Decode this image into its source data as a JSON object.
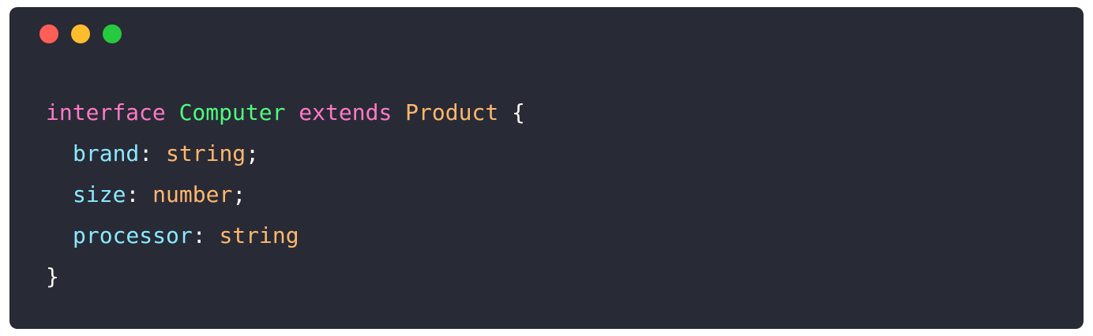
{
  "window_controls": {
    "close_color": "#ff5f56",
    "minimize_color": "#ffbd2e",
    "maximize_color": "#27c93f"
  },
  "colors": {
    "background": "#282a36",
    "keyword": "#ff79c6",
    "class_name": "#50fa7b",
    "type": "#ffb86c",
    "property": "#8be9fd",
    "punctuation": "#f8f8f2"
  },
  "code": {
    "line1": {
      "keyword1": "interface",
      "name": "Computer",
      "keyword2": "extends",
      "base": "Product",
      "brace": "{"
    },
    "line2": {
      "prop": "brand",
      "colon": ":",
      "type": "string",
      "semi": ";"
    },
    "line3": {
      "prop": "size",
      "colon": ":",
      "type": "number",
      "semi": ";"
    },
    "line4": {
      "prop": "processor",
      "colon": ":",
      "type": "string"
    },
    "line5": {
      "brace": "}"
    }
  }
}
